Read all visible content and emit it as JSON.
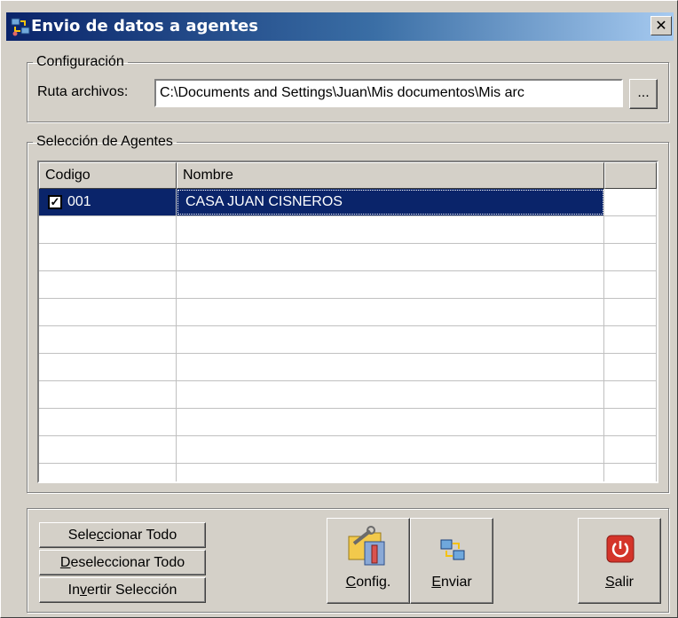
{
  "window": {
    "title": "Envio de datos a agentes",
    "close_glyph": "✕"
  },
  "config_group": {
    "legend": "Configuración",
    "path_label": "Ruta archivos:",
    "path_value": "C:\\Documents and Settings\\Juan\\Mis documentos\\Mis arc",
    "browse_label": "..."
  },
  "agents_group": {
    "legend": "Selección de Agentes",
    "columns": [
      "Codigo",
      "Nombre"
    ],
    "rows": [
      {
        "codigo": "001",
        "nombre": "CASA JUAN CISNEROS",
        "checked": true,
        "selected": true
      }
    ],
    "check_glyph": "✓"
  },
  "actions": {
    "select_all": {
      "pre": "Sele",
      "key": "c",
      "post": "cionar Todo"
    },
    "deselect_all": {
      "pre": "",
      "key": "D",
      "post": "eseleccionar Todo"
    },
    "invert": {
      "pre": "In",
      "key": "v",
      "post": "ertir Selección"
    },
    "config": {
      "pre": "",
      "key": "C",
      "post": "onfig.",
      "icon": "config-tools-icon"
    },
    "send": {
      "pre": "",
      "key": "E",
      "post": "nviar",
      "icon": "send-transfer-icon"
    },
    "exit": {
      "pre": "",
      "key": "S",
      "post": "alir",
      "icon": "power-icon"
    }
  },
  "colors": {
    "title_start": "#0a246a",
    "title_end": "#a6caf0",
    "selection": "#0a246a",
    "face": "#d4d0c8",
    "exit_red": "#d4342a"
  }
}
